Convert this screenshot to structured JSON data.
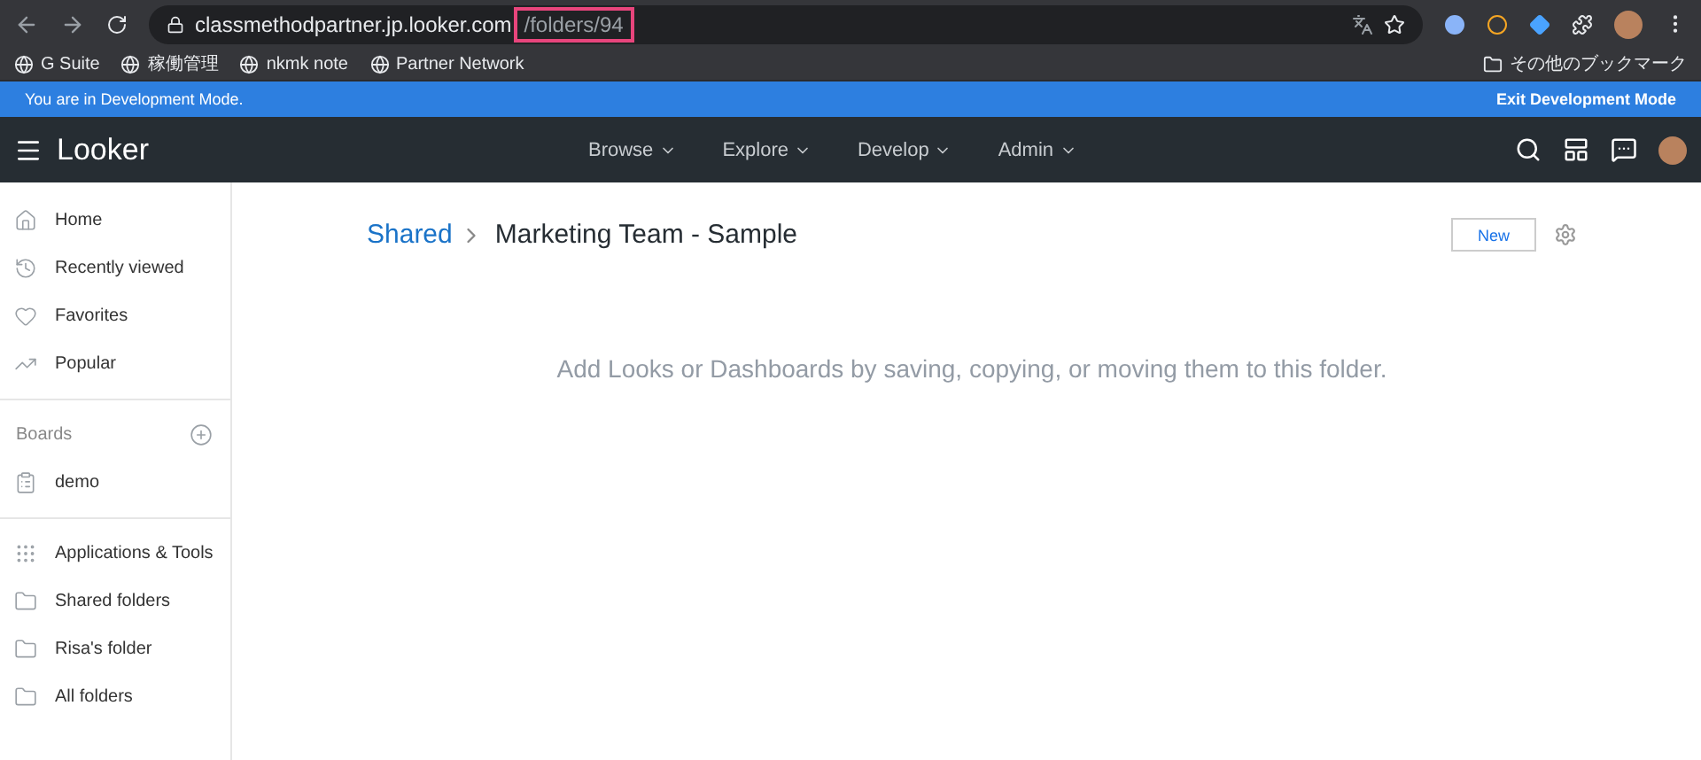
{
  "browser": {
    "url_host": "classmethodpartner.jp.looker.com",
    "url_path": "/folders/94",
    "bookmarks": [
      "G Suite",
      "稼働管理",
      "nkmk note",
      "Partner Network"
    ],
    "other_bookmarks": "その他のブックマーク"
  },
  "dev_banner": {
    "message": "You are in Development Mode.",
    "action": "Exit Development Mode"
  },
  "header": {
    "logo": "Looker",
    "menus": [
      "Browse",
      "Explore",
      "Develop",
      "Admin"
    ]
  },
  "sidebar": {
    "nav": [
      "Home",
      "Recently viewed",
      "Favorites",
      "Popular"
    ],
    "boards_heading": "Boards",
    "boards": [
      "demo"
    ],
    "folders": [
      "Applications & Tools",
      "Shared folders",
      "Risa's folder",
      "All folders"
    ]
  },
  "breadcrumb": {
    "parent": "Shared",
    "current": "Marketing Team - Sample"
  },
  "new_button": "New",
  "empty_message": "Add Looks or Dashboards by saving, copying, or moving them to this folder."
}
